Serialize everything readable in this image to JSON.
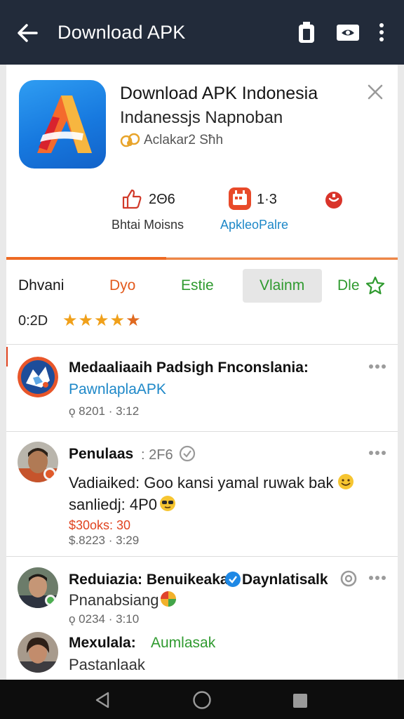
{
  "appbar": {
    "title": "Download APK"
  },
  "app": {
    "title": "Download APK Indonesia",
    "subtitle": "Indanessjs Napnoban",
    "developer": "Aclakar2 Sħh"
  },
  "stats": [
    {
      "value": "2Θ6",
      "label": "Bhtai Moisns",
      "icon": "thumbs-up-icon"
    },
    {
      "value": "1·3",
      "label": "ApkleoPalre",
      "icon": "calendar-icon"
    },
    {
      "icon": "shield-icon"
    }
  ],
  "tabs": [
    {
      "label": "Dhvani"
    },
    {
      "label": "Dyo"
    },
    {
      "label": "Estie"
    },
    {
      "label": "Vlainm"
    },
    {
      "label": "Dle"
    }
  ],
  "rating": {
    "value": "0:2D",
    "stars": 4.5
  },
  "posts": [
    {
      "title": "Medaaliaaih Padsigh Fnconslania:",
      "link": "PawnlaplaAPK",
      "meta": "ǫ 8201 · 3:12"
    },
    {
      "author": "Penulaas",
      "tag": ": 2F6",
      "line1": "Vadiaiked: Goo kansi yamal ruwak bak",
      "line2": "sanliedj: 4P0",
      "price": "$30oks: 30",
      "meta": "$.8223 · 3:29"
    },
    {
      "author": "Reduiazia: Benuikeaka",
      "author_suffix": "Daynlatisalk",
      "line1": "Pnanabsiang",
      "meta": "ǫ 0234 · 3:10"
    },
    {
      "author": "Mexulala:",
      "author_suffix": "Aumlasak",
      "line1": "Pastanlaak"
    }
  ],
  "colors": {
    "appbar": "#222b3a",
    "accent_orange": "#ee6a23",
    "link_blue": "#1e88c8",
    "tab_green": "#2f9a2f",
    "star": "#f0a01a"
  }
}
